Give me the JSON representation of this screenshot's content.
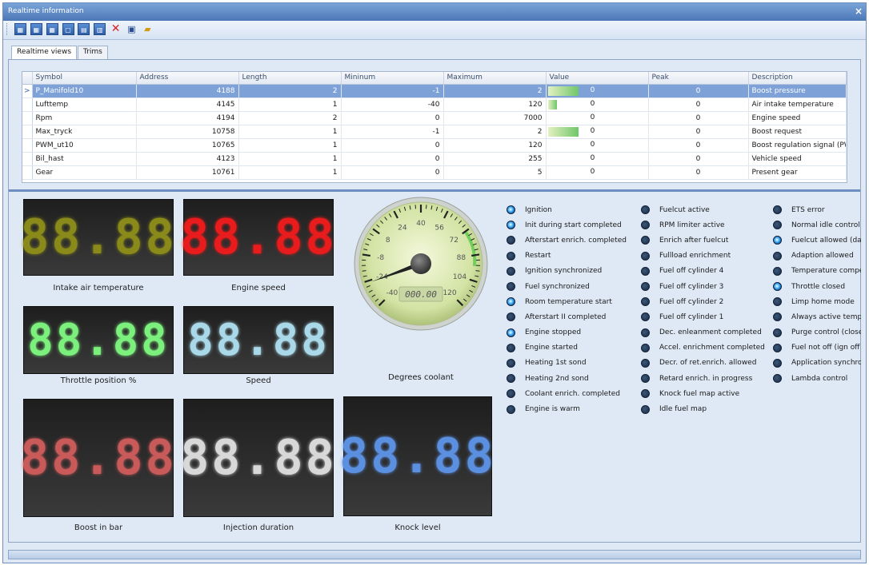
{
  "window": {
    "title": "Realtime information",
    "close": "×"
  },
  "tabs": [
    "Realtime views",
    "Trims"
  ],
  "grid": {
    "columns": [
      "Symbol",
      "Address",
      "Length",
      "Mininum",
      "Maximum",
      "Value",
      "Peak",
      "Description"
    ],
    "selected_indicator": ">",
    "rows": [
      {
        "symbol": "P_Manifold10",
        "address": "4188",
        "length": "2",
        "min": "-1",
        "max": "2",
        "value": "0",
        "bar": 0.9,
        "peak": "0",
        "desc": "Boost pressure",
        "selected": true
      },
      {
        "symbol": "Lufttemp",
        "address": "4145",
        "length": "1",
        "min": "-40",
        "max": "120",
        "value": "0",
        "bar": 0.25,
        "peak": "0",
        "desc": "Air intake temperature"
      },
      {
        "symbol": "Rpm",
        "address": "4194",
        "length": "2",
        "min": "0",
        "max": "7000",
        "value": "0",
        "bar": 0,
        "peak": "0",
        "desc": "Engine speed"
      },
      {
        "symbol": "Max_tryck",
        "address": "10758",
        "length": "1",
        "min": "-1",
        "max": "2",
        "value": "0",
        "bar": 0.9,
        "peak": "0",
        "desc": "Boost request"
      },
      {
        "symbol": "PWM_ut10",
        "address": "10765",
        "length": "1",
        "min": "0",
        "max": "120",
        "value": "0",
        "bar": 0,
        "peak": "0",
        "desc": "Boost regulation signal (PWM)"
      },
      {
        "symbol": "Bil_hast",
        "address": "4123",
        "length": "1",
        "min": "0",
        "max": "255",
        "value": "0",
        "bar": 0,
        "peak": "0",
        "desc": "Vehicle speed"
      },
      {
        "symbol": "Gear",
        "address": "10761",
        "length": "1",
        "min": "0",
        "max": "5",
        "value": "0",
        "bar": 0,
        "peak": "0",
        "desc": "Present gear"
      }
    ]
  },
  "displays": [
    {
      "label": "Intake air temperature",
      "digits": "88.88",
      "color": "#8a8a1a"
    },
    {
      "label": "Engine speed",
      "digits": "88.88",
      "color": "#e81c1c"
    },
    {
      "label": "Throttle position %",
      "digits": "88.88",
      "color": "#7cf07c"
    },
    {
      "label": "Speed",
      "digits": "88.88",
      "color": "#a9d8e8"
    },
    {
      "label": "Boost in bar",
      "digits": "88.88",
      "color": "#c85a5a"
    },
    {
      "label": "Injection duration",
      "digits": "88.88",
      "color": "#d8d8d8"
    },
    {
      "label": "Knock level",
      "digits": "88.88",
      "color": "#5b8fe0"
    }
  ],
  "gauge": {
    "label": "Degrees coolant",
    "readout": "000.00",
    "ticks": [
      "-40",
      "-24",
      "-8",
      "8",
      "24",
      "40",
      "56",
      "72",
      "88",
      "104",
      "120"
    ]
  },
  "leds": {
    "col1": [
      {
        "t": "Ignition",
        "on": true
      },
      {
        "t": "Init during start completed",
        "on": true
      },
      {
        "t": "Afterstart enrich. completed",
        "on": false
      },
      {
        "t": "Restart",
        "on": false
      },
      {
        "t": "Ignition synchronized",
        "on": false
      },
      {
        "t": "Fuel synchronized",
        "on": false
      },
      {
        "t": "Room temperature start",
        "on": true
      },
      {
        "t": "Afterstart II completed",
        "on": false
      },
      {
        "t": "Engine stopped",
        "on": true
      },
      {
        "t": "Engine started",
        "on": false
      },
      {
        "t": "Heating 1st sond",
        "on": false
      },
      {
        "t": "Heating 2nd sond",
        "on": false
      },
      {
        "t": "Coolant enrich. completed",
        "on": false
      },
      {
        "t": "Engine is warm",
        "on": false
      }
    ],
    "col2": [
      {
        "t": "Fuelcut active",
        "on": false
      },
      {
        "t": "RPM limiter active",
        "on": false
      },
      {
        "t": "Enrich after fuelcut",
        "on": false
      },
      {
        "t": "Fullload enrichment",
        "on": false
      },
      {
        "t": "Fuel off cylinder 4",
        "on": false
      },
      {
        "t": "Fuel off cylinder 3",
        "on": false
      },
      {
        "t": "Fuel off cylinder 2",
        "on": false
      },
      {
        "t": "Fuel off cylinder 1",
        "on": false
      },
      {
        "t": "Dec. enleanment completed",
        "on": false
      },
      {
        "t": "Accel. enrichment completed",
        "on": false
      },
      {
        "t": "Decr. of ret.enrich. allowed",
        "on": false
      },
      {
        "t": "Retard enrich. in progress",
        "on": false
      },
      {
        "t": "Knock fuel map active",
        "on": false
      },
      {
        "t": "Idle fuel map",
        "on": false
      }
    ],
    "col3": [
      {
        "t": "ETS error",
        "on": false
      },
      {
        "t": "Normal idle control disat",
        "on": false
      },
      {
        "t": "Fuelcut allowed (dashpc",
        "on": true
      },
      {
        "t": "Adaption allowed",
        "on": false
      },
      {
        "t": "Temperature compensa",
        "on": false
      },
      {
        "t": "Throttle closed",
        "on": true
      },
      {
        "t": "Limp home mode",
        "on": false
      },
      {
        "t": "Always active temp.con",
        "on": false
      },
      {
        "t": "Purge control (closed lo",
        "on": false
      },
      {
        "t": "Fuel not off (ign off syn",
        "on": false
      },
      {
        "t": "Application synchronize",
        "on": false
      },
      {
        "t": "Lambda control",
        "on": false
      }
    ]
  }
}
